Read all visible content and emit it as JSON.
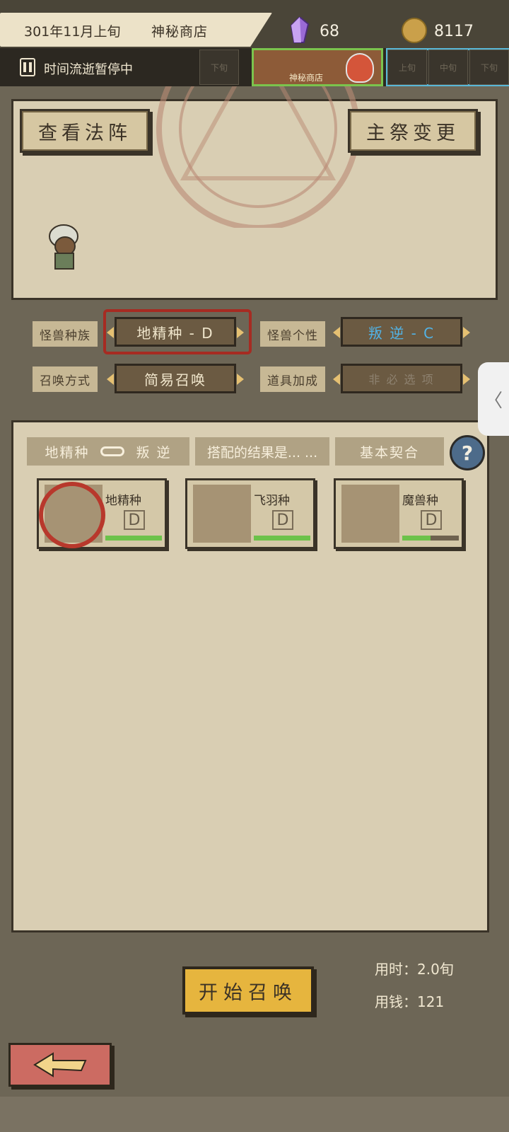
{
  "header": {
    "date": "301年11月上旬",
    "location": "神秘商店",
    "crystal_icon": "purple-crystal-icon",
    "crystals": "68",
    "coin_icon": "gold-coin-icon",
    "coins": "8117"
  },
  "timeline": {
    "status": "时间流逝暂停中",
    "slot_prev": "下旬",
    "shop_slot_label": "神秘商店",
    "slots_next": [
      "上旬",
      "中旬",
      "下旬"
    ]
  },
  "summon": {
    "view_circle_button": "查看法阵",
    "change_priest_button": "主祭变更"
  },
  "options": {
    "race_label": "怪兽种族",
    "race_value": "地精种 - D",
    "personality_label": "怪兽个性",
    "personality_value": "叛 逆 - C",
    "method_label": "召唤方式",
    "method_value": "简易召唤",
    "item_label": "道具加成",
    "item_value": "非 必 选 项"
  },
  "result": {
    "race_tag": "地精种",
    "personality_tag": "叛 逆",
    "result_tag": "搭配的结果是... ...",
    "contract_tag": "基本契合"
  },
  "cards": [
    {
      "name": "地精种",
      "grade": "D",
      "bar_fill": 1.0,
      "icon": "goblin-skull-icon",
      "selected": true
    },
    {
      "name": "飞羽种",
      "grade": "D",
      "bar_fill": 1.0,
      "icon": "wings-icon",
      "selected": false
    },
    {
      "name": "魔兽种",
      "grade": "D",
      "bar_fill": 0.5,
      "icon": "beast-icon",
      "selected": false
    }
  ],
  "footer": {
    "start_button": "开始召唤",
    "time_cost": "用时：2.0旬",
    "money_cost": "用钱：121"
  },
  "colors": {
    "accent_gold": "#e6b53e",
    "selected_red": "#a62b22",
    "personality_blue": "#52b3e6",
    "bar_green": "#6cc24a"
  }
}
